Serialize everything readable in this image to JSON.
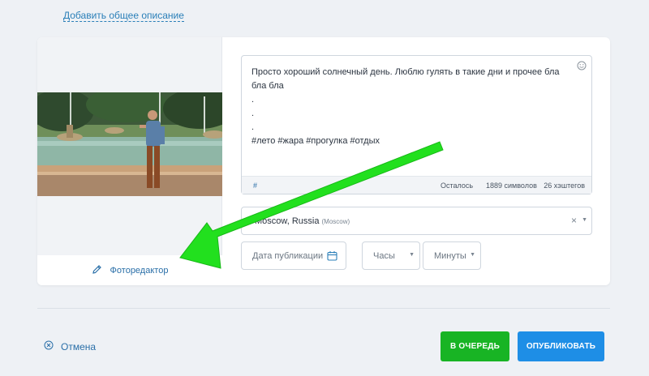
{
  "header": {
    "add_description_link": "Добавить общее описание"
  },
  "post": {
    "text": "Просто хороший солнечный день. Люблю гулять в такие дни и прочее бла бла бла\n.\n.\n.\n#лето #жара #прогулка #отдых",
    "counter": {
      "hash": "#",
      "remaining_label": "Осталось",
      "symbols": "1889 символов",
      "hashtags": "26 хэштегов"
    }
  },
  "photo_editor": {
    "label": "Фоторедактор"
  },
  "location": {
    "value": "Moscow, Russia",
    "city": "(Moscow)",
    "clear": "×"
  },
  "schedule": {
    "date_placeholder": "Дата публикации",
    "hours_placeholder": "Часы",
    "minutes_placeholder": "Минуты"
  },
  "actions": {
    "cancel_label": "Отмена",
    "queue_label": "В ОЧЕРЕДЬ",
    "publish_label": "ОПУБЛИКОВАТЬ"
  },
  "colors": {
    "accent_blue": "#1e8ee6",
    "queue_green": "#18b424",
    "link_blue": "#2a7fb8",
    "annotation_arrow": "#22e01e"
  },
  "icons": {
    "smile": "smile-icon",
    "pencil": "pencil-icon",
    "calendar": "calendar-icon",
    "cancel": "close-circle-icon"
  }
}
